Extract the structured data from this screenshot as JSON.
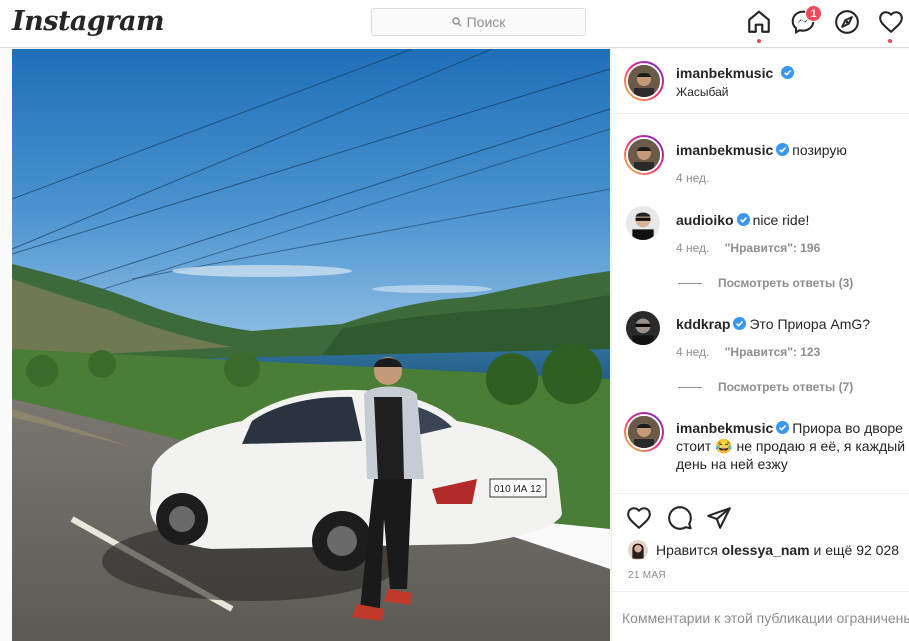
{
  "topbar": {
    "logo": "Instagram",
    "search_placeholder": "Поиск",
    "messages_badge": "1"
  },
  "header": {
    "username": "imanbekmusic",
    "location": "Жасыбай"
  },
  "comments": [
    {
      "username": "imanbekmusic",
      "text": "позирую",
      "age": "4 нед.",
      "likes": "",
      "replies": ""
    },
    {
      "username": "audioiko",
      "text": "nice ride!",
      "age": "4 нед.",
      "likes": "\"Нравится\": 196",
      "replies": "Посмотреть ответы (3)"
    },
    {
      "username": "kddkrap",
      "text": "Это Приора AmG?",
      "age": "4 нед.",
      "likes": "\"Нравится\": 123",
      "replies": "Посмотреть ответы (7)"
    },
    {
      "username": "imanbekmusic",
      "text": "Приора во дворе стоит 😂 не продаю я её, я каждый день на ней езжу",
      "age": "",
      "likes": "",
      "replies": ""
    }
  ],
  "likes": {
    "prefix": "Нравится",
    "user": "olessya_nam",
    "suffix": "и ещё 92 028"
  },
  "date": "21 МАЯ",
  "comment_placeholder": "Комментарии к этой публикации ограничены",
  "colors": {
    "verified": "#3897f0",
    "notification": "#ed4956"
  },
  "icons": [
    "home-icon",
    "messenger-icon",
    "explore-icon",
    "activity-heart-icon",
    "like-icon",
    "comment-icon",
    "share-icon",
    "search-icon",
    "verified-icon"
  ]
}
